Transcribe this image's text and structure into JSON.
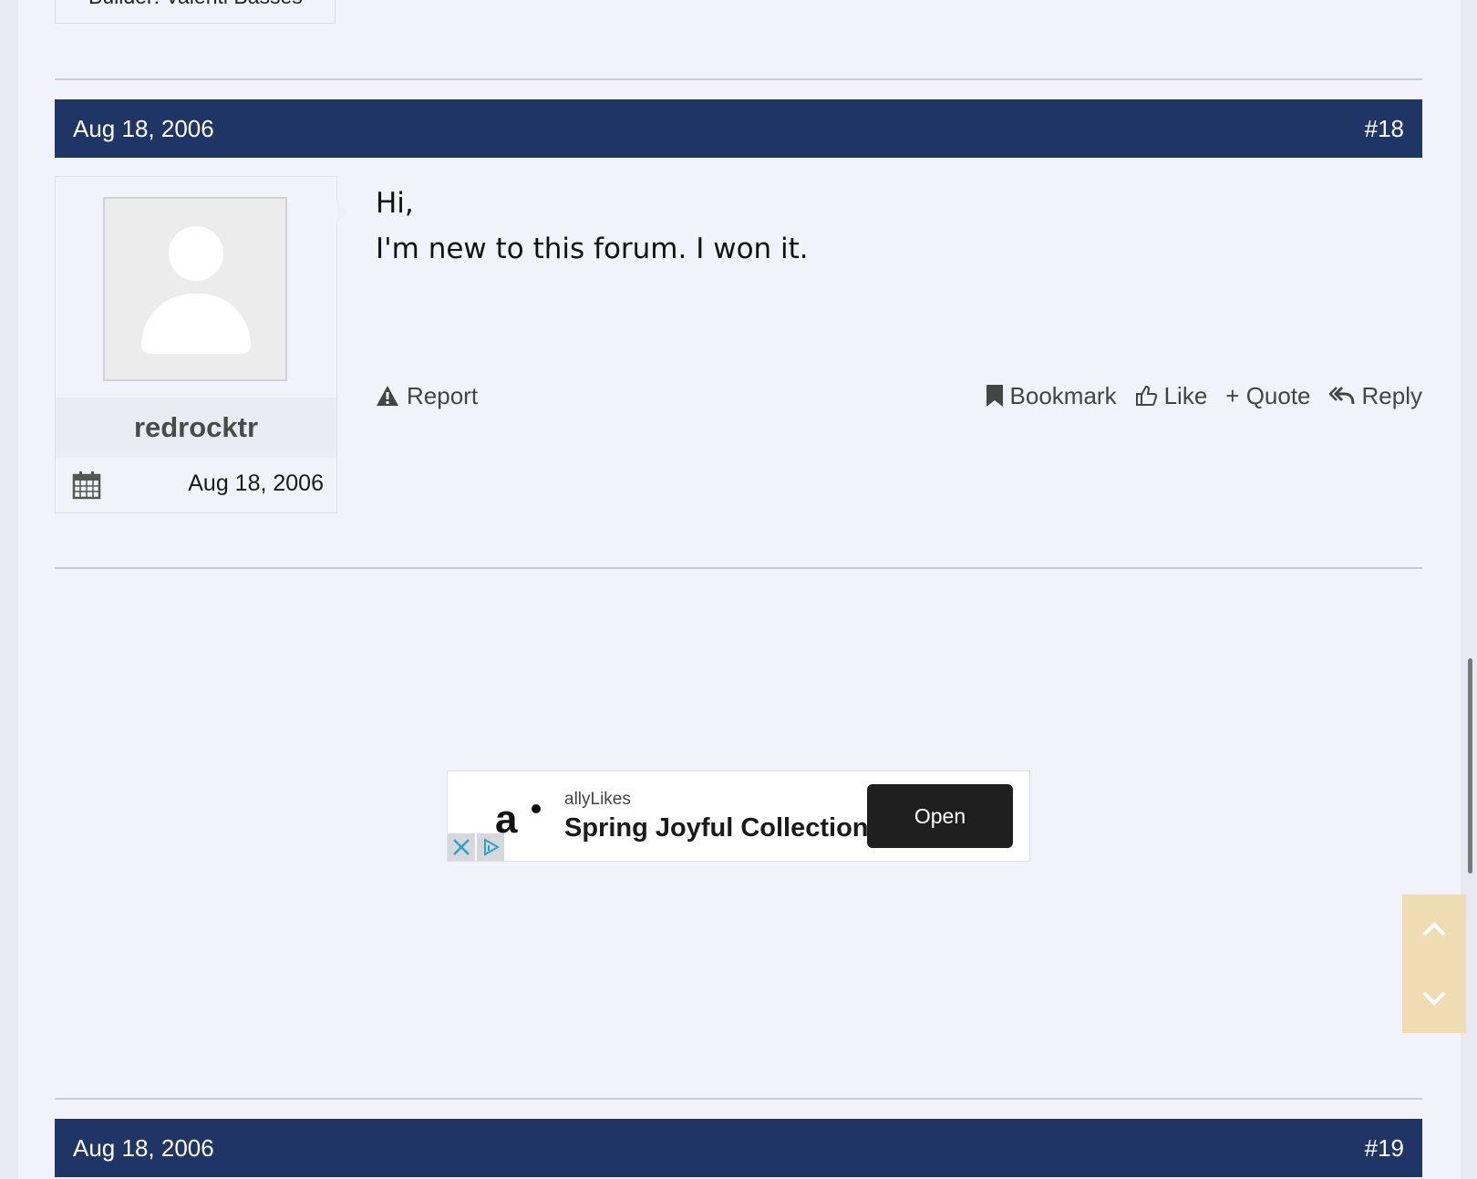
{
  "previous_post": {
    "builder_text": "Builder: Valenti Basses"
  },
  "post18": {
    "date": "Aug 18, 2006",
    "number": "#18",
    "author": {
      "username": "redrocktr",
      "joined": "Aug 18, 2006"
    },
    "message": {
      "line1": "Hi,",
      "line2": "I'm new to this forum. I won it."
    },
    "actions": {
      "report": "Report",
      "bookmark": "Bookmark",
      "like": "Like",
      "quote": "+ Quote",
      "reply": "Reply"
    }
  },
  "ad": {
    "brand": "allyLikes",
    "title": "Spring Joyful Collection",
    "cta": "Open"
  },
  "post19": {
    "date": "Aug 18, 2006",
    "number": "#19"
  },
  "colors": {
    "header_bg": "#1f3566",
    "page_bg": "#f2f3fa",
    "scroll_nav_bg": "#efdcb3",
    "ad_button": "#1f1f1f"
  },
  "icons": {
    "report": "warning-triangle-icon",
    "bookmark": "bookmark-icon",
    "like": "thumbs-up-icon",
    "reply": "reply-all-icon",
    "joined": "calendar-icon",
    "scroll_up": "chevron-up-icon",
    "scroll_down": "chevron-down-icon"
  }
}
